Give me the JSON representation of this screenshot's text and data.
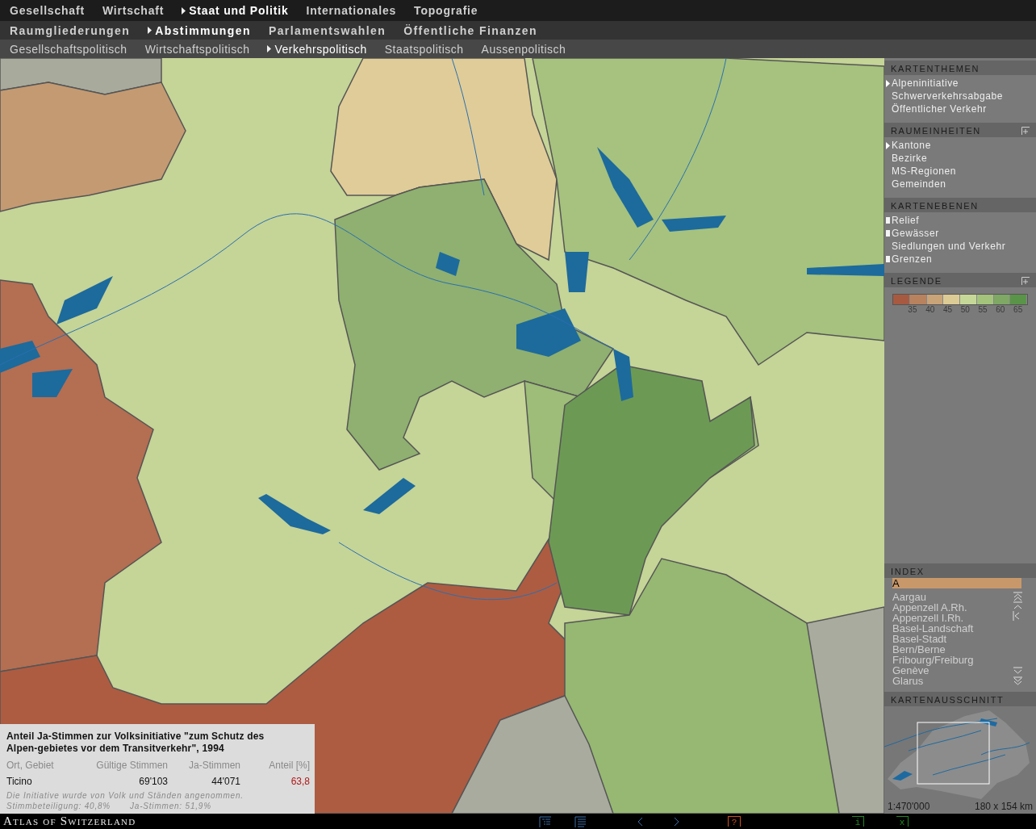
{
  "menus": [
    {
      "items": [
        {
          "label": "Gesellschaft",
          "selected": false
        },
        {
          "label": "Wirtschaft",
          "selected": false
        },
        {
          "label": "Staat und Politik",
          "selected": true
        },
        {
          "label": "Internationales",
          "selected": false
        },
        {
          "label": "Topografie",
          "selected": false
        }
      ]
    },
    {
      "items": [
        {
          "label": "Raumgliederungen",
          "selected": false
        },
        {
          "label": "Abstimmungen",
          "selected": true
        },
        {
          "label": "Parlamentswahlen",
          "selected": false
        },
        {
          "label": "Öffentliche Finanzen",
          "selected": false
        }
      ]
    },
    {
      "items": [
        {
          "label": "Gesellschaftspolitisch",
          "selected": false
        },
        {
          "label": "Wirtschaftspolitisch",
          "selected": false
        },
        {
          "label": "Verkehrspolitisch",
          "selected": true
        },
        {
          "label": "Staatspolitisch",
          "selected": false
        },
        {
          "label": "Aussenpolitisch",
          "selected": false
        }
      ]
    }
  ],
  "sidebar": {
    "sections": [
      {
        "title": "KARTENTHEMEN",
        "kind": "radio",
        "expandable": false,
        "items": [
          {
            "label": "Alpeninitiative",
            "selected": true
          },
          {
            "label": "Schwerverkehrsabgabe",
            "selected": false
          },
          {
            "label": "Öffentlicher Verkehr",
            "selected": false
          }
        ]
      },
      {
        "title": "RAUMEINHEITEN",
        "kind": "radio",
        "expandable": true,
        "items": [
          {
            "label": "Kantone",
            "selected": true
          },
          {
            "label": "Bezirke",
            "selected": false
          },
          {
            "label": "MS-Regionen",
            "selected": false
          },
          {
            "label": "Gemeinden",
            "selected": false
          }
        ]
      },
      {
        "title": "KARTENEBENEN",
        "kind": "check",
        "expandable": false,
        "items": [
          {
            "label": "Relief",
            "checked": true
          },
          {
            "label": "Gewässer",
            "checked": true
          },
          {
            "label": "Siedlungen und Verkehr",
            "checked": false
          },
          {
            "label": "Grenzen",
            "checked": true
          }
        ]
      }
    ],
    "legend": {
      "title": "LEGENDE",
      "expandable": true,
      "swatches": [
        {
          "color": "#a85a40"
        },
        {
          "color": "#b8825e"
        },
        {
          "color": "#c8a478"
        },
        {
          "color": "#dccb94"
        },
        {
          "color": "#c6d898"
        },
        {
          "color": "#a4c47c"
        },
        {
          "color": "#7ea864"
        },
        {
          "color": "#5a9448"
        }
      ],
      "labels": [
        "35",
        "40",
        "45",
        "50",
        "55",
        "60",
        "65"
      ]
    },
    "index": {
      "title": "INDEX",
      "search": {
        "value": "A"
      },
      "items": [
        "Aargau",
        "Appenzell A.Rh.",
        "Appenzell I.Rh.",
        "Basel-Landschaft",
        "Basel-Stadt",
        "Bern/Berne",
        "Fribourg/Freiburg",
        "Genève",
        "Glarus"
      ]
    },
    "overview": {
      "title": "KARTENAUSSCHNITT",
      "scale": "1:470'000",
      "extent": "180 x 154 km"
    }
  },
  "info": {
    "title": "Anteil Ja-Stimmen zur Volksinitiative \"zum Schutz des Alpen-gebietes vor dem Transitverkehr\", 1994",
    "columns": [
      "Ort, Gebiet",
      "Gültige Stimmen",
      "Ja-Stimmen",
      "Anteil [%]"
    ],
    "row": [
      "Ticino",
      "69'103",
      "44'071",
      "63,8"
    ],
    "notes": [
      "Die Initiative wurde von Volk und Ständen angenommen.",
      "Stimmbeteiligung: 40,8%",
      "Ja-Stimmen: 51,9%"
    ]
  },
  "footer": {
    "brand": "Atlas of Switzerland",
    "buttons": [
      {
        "kind": "list"
      },
      {
        "kind": "text"
      },
      {
        "kind": "back"
      },
      {
        "kind": "forward"
      },
      {
        "kind": "help",
        "label": "?"
      },
      {
        "kind": "info",
        "label": "i"
      },
      {
        "kind": "close",
        "label": "x"
      }
    ]
  }
}
